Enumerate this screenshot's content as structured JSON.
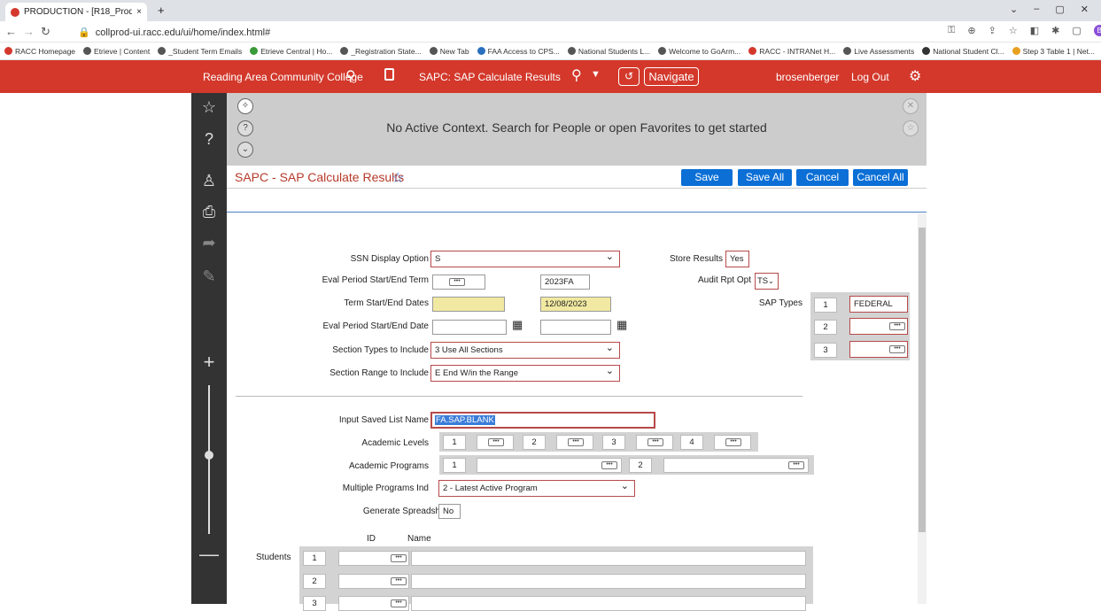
{
  "browser": {
    "tab_title": "PRODUCTION - [R18_Prod]",
    "tab_close": "×",
    "new_tab": "+",
    "url": "collprod-ui.racc.edu/ui/home/index.html#",
    "window_controls": [
      "⌄",
      "–",
      "▢",
      "✕"
    ],
    "bookmarks": [
      "RACC Homepage",
      "Etrieve | Content",
      "_Student Term Emails",
      "Etrieve Central | Ho...",
      "_Registration State...",
      "New Tab",
      "FAA Access to CPS...",
      "National Students L...",
      "Welcome to GoArm...",
      "RACC - INTRANet H...",
      "Live Assessments",
      "National Student Cl...",
      "Step 3 Table 1 | Net..."
    ]
  },
  "header": {
    "institution": "Reading Area Community College",
    "form_name": "SAPC: SAP Calculate Results",
    "navigate": "Navigate",
    "user": "brosenberger",
    "logout": "Log Out"
  },
  "context": {
    "message": "No Active Context. Search for People or open Favorites to get started"
  },
  "form": {
    "title": "SAPC - SAP Calculate Results",
    "buttons": {
      "save": "Save",
      "save_all": "Save All",
      "cancel": "Cancel",
      "cancel_all": "Cancel All"
    },
    "ssn_label": "SSN Display Option",
    "ssn_value": "S",
    "store_label": "Store Results",
    "store_value": "Yes",
    "eval_term_label": "Eval Period Start/End Term",
    "eval_term_end": "2023FA",
    "audit_label": "Audit Rpt Opt",
    "audit_value": "TS",
    "term_dates_label": "Term Start/End Dates",
    "term_end_date": "12/08/2023",
    "sap_types_label": "SAP Types",
    "sap_types": [
      {
        "n": "1",
        "v": "FEDERAL"
      },
      {
        "n": "2",
        "v": ""
      },
      {
        "n": "3",
        "v": ""
      }
    ],
    "eval_dates_label": "Eval Period Start/End Date",
    "section_types_label": "Section Types to Include",
    "section_types_value": "3 Use All Sections",
    "section_range_label": "Section Range to Include",
    "section_range_value": "E End W/in the Range",
    "saved_list_label": "Input Saved List Name",
    "saved_list_value": "FA.SAP.BLANK",
    "acad_levels_label": "Academic Levels",
    "acad_levels_nums": [
      "1",
      "2",
      "3",
      "4"
    ],
    "acad_programs_label": "Academic Programs",
    "acad_programs_nums": [
      "1",
      "2"
    ],
    "mult_prog_label": "Multiple Programs Ind",
    "mult_prog_value": "2 - Latest Active Program",
    "spreadsheet_label": "Generate Spreadsheet",
    "spreadsheet_value": "No",
    "id_header": "ID",
    "name_header": "Name",
    "students_label": "Students",
    "student_rows": [
      "1",
      "2",
      "3"
    ]
  }
}
